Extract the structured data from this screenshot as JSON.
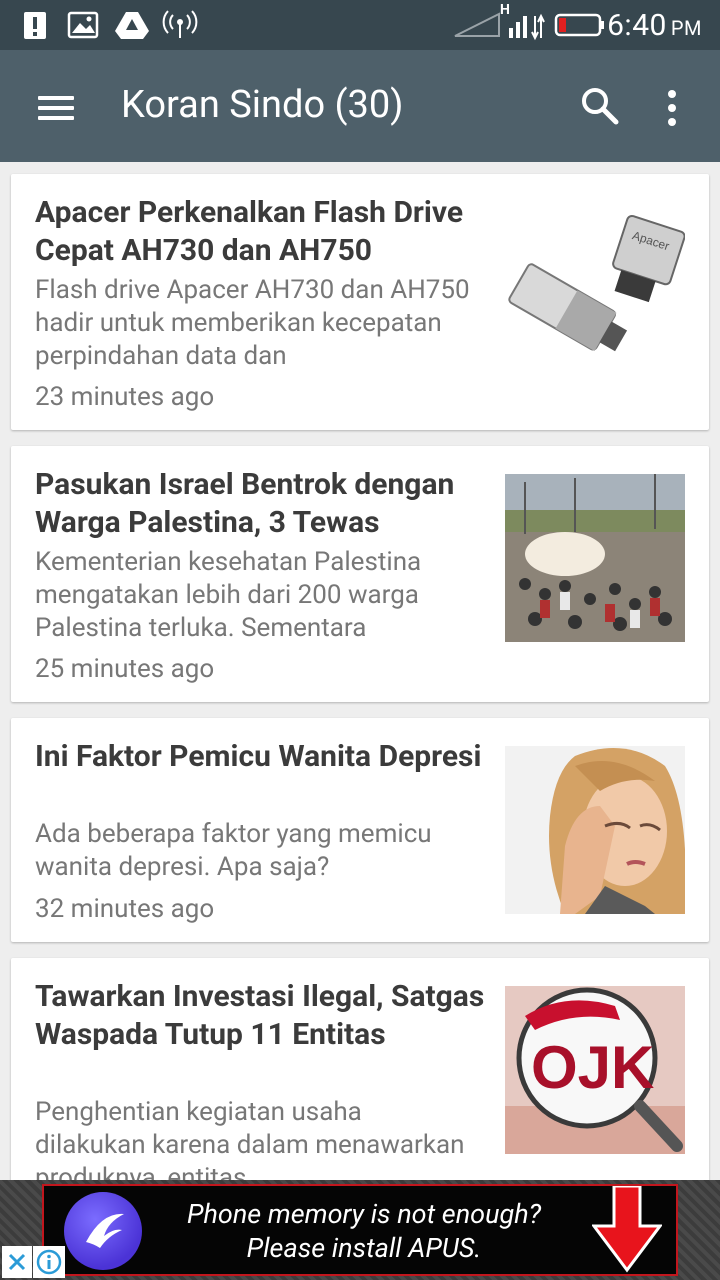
{
  "status_bar": {
    "time": "6:40",
    "ampm": "PM",
    "network_type": "H",
    "icons": [
      "alert-icon",
      "gallery-icon",
      "drive-icon",
      "hotspot-icon",
      "signal-icon",
      "battery-icon"
    ]
  },
  "app_bar": {
    "title": "Koran Sindo (30)",
    "icons": [
      "menu-icon",
      "search-icon",
      "more-icon"
    ]
  },
  "articles": [
    {
      "title": "Apacer Perkenalkan Flash Drive Cepat AH730 dan AH750",
      "summary": "Flash drive Apacer AH730 dan AH750 hadir untuk memberikan kecepatan perpindahan data dan",
      "time": "23 minutes ago",
      "thumb_label": "Apacer"
    },
    {
      "title": "Pasukan Israel Bentrok dengan Warga Palestina, 3 Tewas",
      "summary": "Kementerian kesehatan Palestina mengatakan lebih dari 200 warga Palestina terluka. Sementara",
      "time": "25 minutes ago"
    },
    {
      "title": "Ini Faktor Pemicu Wanita Depresi",
      "summary": "Ada beberapa faktor yang memicu wanita depresi. Apa saja?",
      "time": "32 minutes ago"
    },
    {
      "title": "Tawarkan Investasi Ilegal, Satgas Waspada Tutup 11 Entitas",
      "summary": "Penghentian kegiatan usaha dilakukan karena dalam menawarkan produknya, entitas",
      "time": "",
      "thumb_label": "OJK"
    }
  ],
  "ad": {
    "line1": "Phone memory is not enough?",
    "line2": "Please install APUS.",
    "close_icon": "close-icon",
    "info_icon": "info-icon"
  },
  "colors": {
    "status_bar": "#37474f",
    "app_bar": "#4e606a",
    "background": "#eeeeee",
    "ad_border": "#c2161d",
    "ad_arrow": "#e8141c"
  }
}
